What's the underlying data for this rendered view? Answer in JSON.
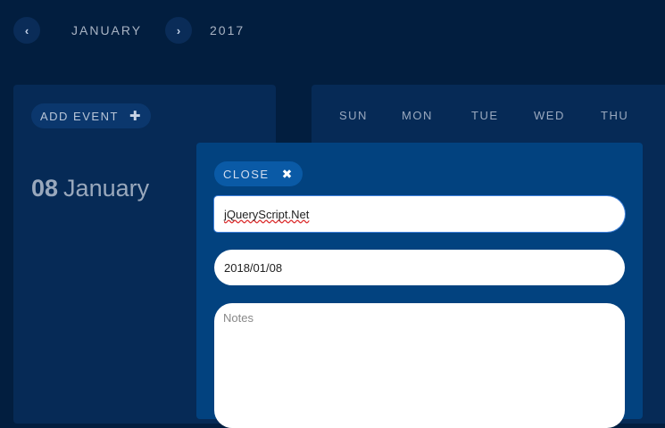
{
  "header": {
    "prev_icon": "chevron-left-icon",
    "prev_glyph": "‹",
    "month": "JANUARY",
    "next_icon": "chevron-right-icon",
    "next_glyph": "›",
    "year": "2017"
  },
  "sidebar": {
    "add_event_label": "ADD EVENT",
    "add_icon": "plus-icon",
    "add_glyph": "✚",
    "selected_day": "08",
    "selected_month": "January"
  },
  "calendar": {
    "weekdays": [
      "SUN",
      "MON",
      "TUE",
      "WED",
      "THU"
    ]
  },
  "modal": {
    "close_label": "CLOSE",
    "close_icon": "close-icon",
    "close_glyph": "✖",
    "title_value": "jQueryScript.Net",
    "date_value": "2018/01/08",
    "notes_placeholder": "Notes"
  },
  "colors": {
    "background": "#021e3f",
    "panel": "#062a56",
    "modal": "#02427f",
    "accent": "#0a5aa6"
  }
}
